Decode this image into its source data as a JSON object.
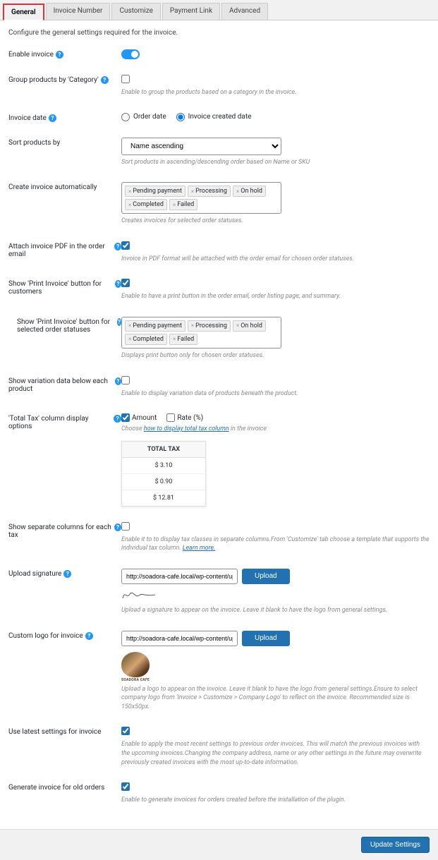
{
  "tabs": [
    "General",
    "Invoice Number",
    "Customize",
    "Payment Link",
    "Advanced"
  ],
  "intro": "Configure the general settings required for the invoice.",
  "enable_invoice": {
    "label": "Enable invoice"
  },
  "group_category": {
    "label": "Group products by 'Category'",
    "hint": "Enable to group the products based on a category in the invoice."
  },
  "invoice_date": {
    "label": "Invoice date",
    "opt1": "Order date",
    "opt2": "Invoice created date"
  },
  "sort": {
    "label": "Sort products by",
    "value": "Name ascending",
    "hint": "Sort products in ascending/descending order based on Name or SKU"
  },
  "auto_create": {
    "label": "Create invoice automatically",
    "tags": [
      "Pending payment",
      "Processing",
      "On hold",
      "Completed",
      "Failed"
    ],
    "hint": "Creates invoices for selected order statuses."
  },
  "attach_pdf": {
    "label": "Attach invoice PDF in the order email",
    "hint": "Invoice in PDF format will be attached with the order email for chosen order statuses."
  },
  "print_btn": {
    "label": "Show 'Print Invoice' button for customers",
    "hint": "Enable to have a print button in the order email, order listing page, and summary."
  },
  "print_statuses": {
    "label": "Show 'Print Invoice' button for selected order statuses",
    "tags": [
      "Pending payment",
      "Processing",
      "On hold",
      "Completed",
      "Failed"
    ],
    "hint": "Displays print button only for chosen order statuses."
  },
  "variation": {
    "label": "Show variation data below each product",
    "hint": "Enable to display variation data of products beneath the product."
  },
  "total_tax": {
    "label": "'Total Tax' column display options",
    "opt1": "Amount",
    "opt2": "Rate (%)",
    "hint_pre": "Choose ",
    "hint_link": "how to display total tax column",
    "hint_post": " in the invoice",
    "table_header": "TOTAL TAX",
    "rows": [
      "$ 3.10",
      "$ 0.90",
      "$ 12.81"
    ]
  },
  "sep_cols": {
    "label": "Show separate columns for each tax",
    "hint_pre": "Enable it to to display tax classes in separate columns.From 'Customize' tab choose a template that supports the individual tax column. ",
    "hint_link": "Learn more."
  },
  "signature": {
    "label": "Upload signature",
    "value": "http://soadora-cafe.local/wp-content/up",
    "btn": "Upload",
    "hint": "Upload a signature to appear on the invoice. Leave it blank to have the logo from general settings."
  },
  "logo": {
    "label": "Custom logo for invoice",
    "value": "http://soadora-cafe.local/wp-content/up",
    "btn": "Upload",
    "logo_text": "SOADORA CAFE",
    "hint": "Upload a logo to appear on the invoice. Leave it blank to have the logo from general settings.Ensure to select company logo from 'Invoice > Customize > Company Logo' to reflect on the invoice. Recommended size is 150x50px."
  },
  "latest": {
    "label": "Use latest settings for invoice",
    "hint": "Enable to apply the most recent settings to previous order invoices. This will match the previous invoices with the upcoming invoices.Changing the company address, name or any other settings in the future may overwrite previously created invoices with the most up-to-date information."
  },
  "old_orders": {
    "label": "Generate invoice for old orders",
    "hint": "Enable to generate invoices for orders created before the installation of the plugin."
  },
  "footer_btn": "Update Settings"
}
